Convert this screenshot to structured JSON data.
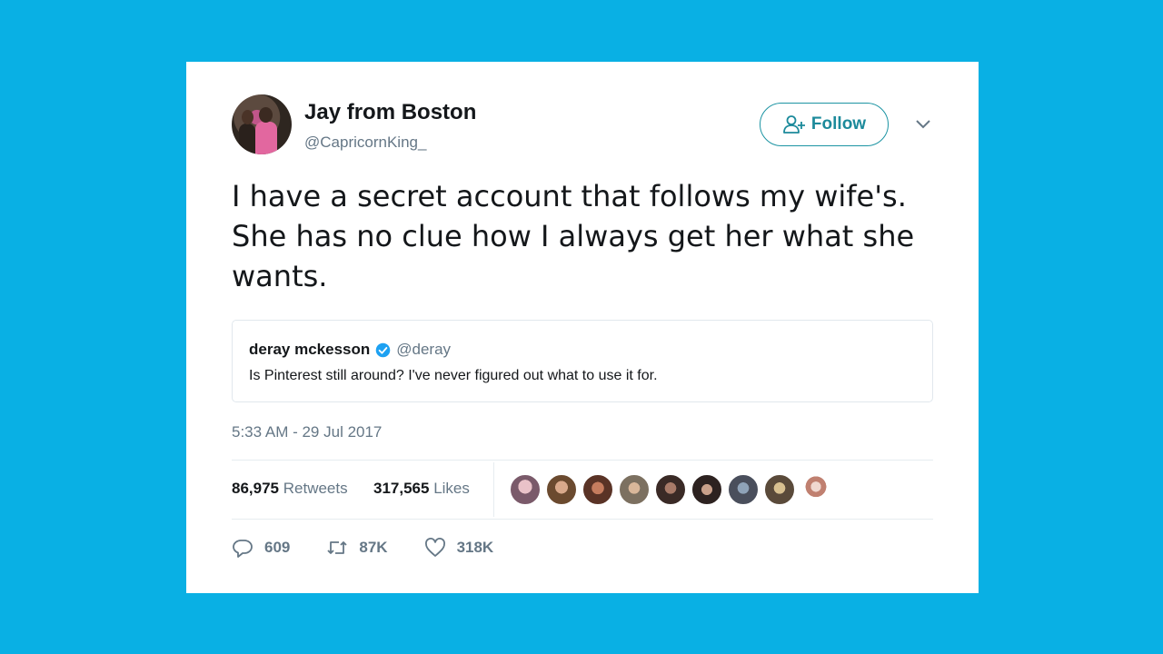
{
  "tweet": {
    "author_name": "Jay from Boston",
    "author_handle": "@CapricornKing_",
    "follow_label": "Follow",
    "text": "I have a secret account that follows my wife's. She has no clue how I always get her what she wants.",
    "timestamp": "5:33 AM - 29 Jul 2017"
  },
  "quoted": {
    "name": "deray mckesson",
    "handle": "@deray",
    "text": "Is Pinterest still around? I've never figured out what to use it for."
  },
  "stats": {
    "retweets_count": "86,975",
    "retweets_label": "Retweets",
    "likes_count": "317,565",
    "likes_label": "Likes"
  },
  "actions": {
    "replies": "609",
    "retweets": "87K",
    "likes": "318K"
  },
  "icons": {
    "follow": "add-user-icon",
    "more": "chevron-down-icon",
    "verified": "verified-badge-icon",
    "reply": "reply-icon",
    "retweet": "retweet-icon",
    "like": "heart-icon"
  },
  "colors": {
    "background": "#09b0e4",
    "follow_accent": "#1c8a9b",
    "verified": "#1da1f2",
    "muted_text": "#657786"
  }
}
